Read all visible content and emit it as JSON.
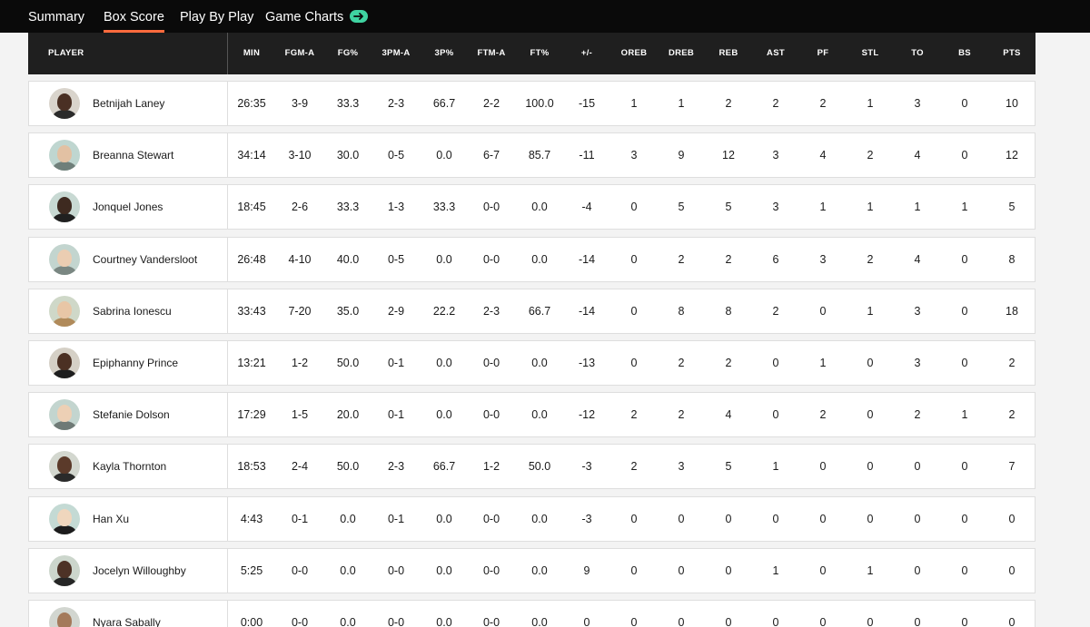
{
  "tabs": [
    {
      "label": "Summary",
      "active": false
    },
    {
      "label": "Box Score",
      "active": true
    },
    {
      "label": "Play By Play",
      "active": false
    },
    {
      "label": "Game Charts",
      "active": false
    }
  ],
  "colors": {
    "accent_underline": "#ff6a3d",
    "arrow_pill": "#3fd3a1"
  },
  "game_charts_icon": "arrow-right-icon",
  "columns": [
    "PLAYER",
    "MIN",
    "FGM-A",
    "FG%",
    "3PM-A",
    "3P%",
    "FTM-A",
    "FT%",
    "+/-",
    "OREB",
    "DREB",
    "REB",
    "AST",
    "PF",
    "STL",
    "TO",
    "BS",
    "PTS"
  ],
  "players": [
    {
      "name": "Betnijah Laney",
      "stats": [
        "26:35",
        "3-9",
        "33.3",
        "2-3",
        "66.7",
        "2-2",
        "100.0",
        "-15",
        "1",
        "1",
        "2",
        "2",
        "2",
        "1",
        "3",
        "0",
        "10"
      ]
    },
    {
      "name": "Breanna Stewart",
      "stats": [
        "34:14",
        "3-10",
        "30.0",
        "0-5",
        "0.0",
        "6-7",
        "85.7",
        "-11",
        "3",
        "9",
        "12",
        "3",
        "4",
        "2",
        "4",
        "0",
        "12"
      ]
    },
    {
      "name": "Jonquel Jones",
      "stats": [
        "18:45",
        "2-6",
        "33.3",
        "1-3",
        "33.3",
        "0-0",
        "0.0",
        "-4",
        "0",
        "5",
        "5",
        "3",
        "1",
        "1",
        "1",
        "1",
        "5"
      ]
    },
    {
      "name": "Courtney Vandersloot",
      "stats": [
        "26:48",
        "4-10",
        "40.0",
        "0-5",
        "0.0",
        "0-0",
        "0.0",
        "-14",
        "0",
        "2",
        "2",
        "6",
        "3",
        "2",
        "4",
        "0",
        "8"
      ]
    },
    {
      "name": "Sabrina Ionescu",
      "stats": [
        "33:43",
        "7-20",
        "35.0",
        "2-9",
        "22.2",
        "2-3",
        "66.7",
        "-14",
        "0",
        "8",
        "8",
        "2",
        "0",
        "1",
        "3",
        "0",
        "18"
      ]
    },
    {
      "name": "Epiphanny Prince",
      "stats": [
        "13:21",
        "1-2",
        "50.0",
        "0-1",
        "0.0",
        "0-0",
        "0.0",
        "-13",
        "0",
        "2",
        "2",
        "0",
        "1",
        "0",
        "3",
        "0",
        "2"
      ]
    },
    {
      "name": "Stefanie Dolson",
      "stats": [
        "17:29",
        "1-5",
        "20.0",
        "0-1",
        "0.0",
        "0-0",
        "0.0",
        "-12",
        "2",
        "2",
        "4",
        "0",
        "2",
        "0",
        "2",
        "1",
        "2"
      ]
    },
    {
      "name": "Kayla Thornton",
      "stats": [
        "18:53",
        "2-4",
        "50.0",
        "2-3",
        "66.7",
        "1-2",
        "50.0",
        "-3",
        "2",
        "3",
        "5",
        "1",
        "0",
        "0",
        "0",
        "0",
        "7"
      ]
    },
    {
      "name": "Han Xu",
      "stats": [
        "4:43",
        "0-1",
        "0.0",
        "0-1",
        "0.0",
        "0-0",
        "0.0",
        "-3",
        "0",
        "0",
        "0",
        "0",
        "0",
        "0",
        "0",
        "0",
        "0"
      ]
    },
    {
      "name": "Jocelyn Willoughby",
      "stats": [
        "5:25",
        "0-0",
        "0.0",
        "0-0",
        "0.0",
        "0-0",
        "0.0",
        "9",
        "0",
        "0",
        "0",
        "1",
        "0",
        "1",
        "0",
        "0",
        "0"
      ]
    },
    {
      "name": "Nyara Sabally",
      "stats": [
        "0:00",
        "0-0",
        "0.0",
        "0-0",
        "0.0",
        "0-0",
        "0.0",
        "0",
        "0",
        "0",
        "0",
        "0",
        "0",
        "0",
        "0",
        "0",
        "0"
      ]
    }
  ]
}
